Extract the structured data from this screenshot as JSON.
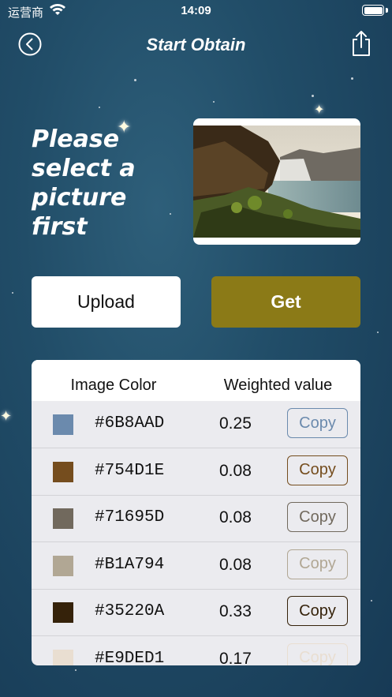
{
  "status_bar": {
    "carrier": "运营商",
    "time": "14:09"
  },
  "nav": {
    "title": "Start Obtain",
    "back_icon": "back-circle-icon",
    "share_icon": "share-icon"
  },
  "prompt": "Please select a picture first",
  "buttons": {
    "upload": "Upload",
    "get": "Get"
  },
  "colors": {
    "get_button": "#8B7A17"
  },
  "table": {
    "headers": {
      "color": "Image Color",
      "weight": "Weighted value"
    },
    "copy_label": "Copy",
    "rows": [
      {
        "hex": "#6B8AAD",
        "swatch": "#6B8AAD",
        "weight": "0.25"
      },
      {
        "hex": "#754D1E",
        "swatch": "#754D1E",
        "weight": "0.08"
      },
      {
        "hex": "#71695D",
        "swatch": "#71695D",
        "weight": "0.08"
      },
      {
        "hex": "#B1A794",
        "swatch": "#B1A794",
        "weight": "0.08"
      },
      {
        "hex": "#35220A",
        "swatch": "#35220A",
        "weight": "0.33"
      },
      {
        "hex": "#E9DED1",
        "swatch": "#E9DED1",
        "weight": "0.17"
      }
    ]
  }
}
